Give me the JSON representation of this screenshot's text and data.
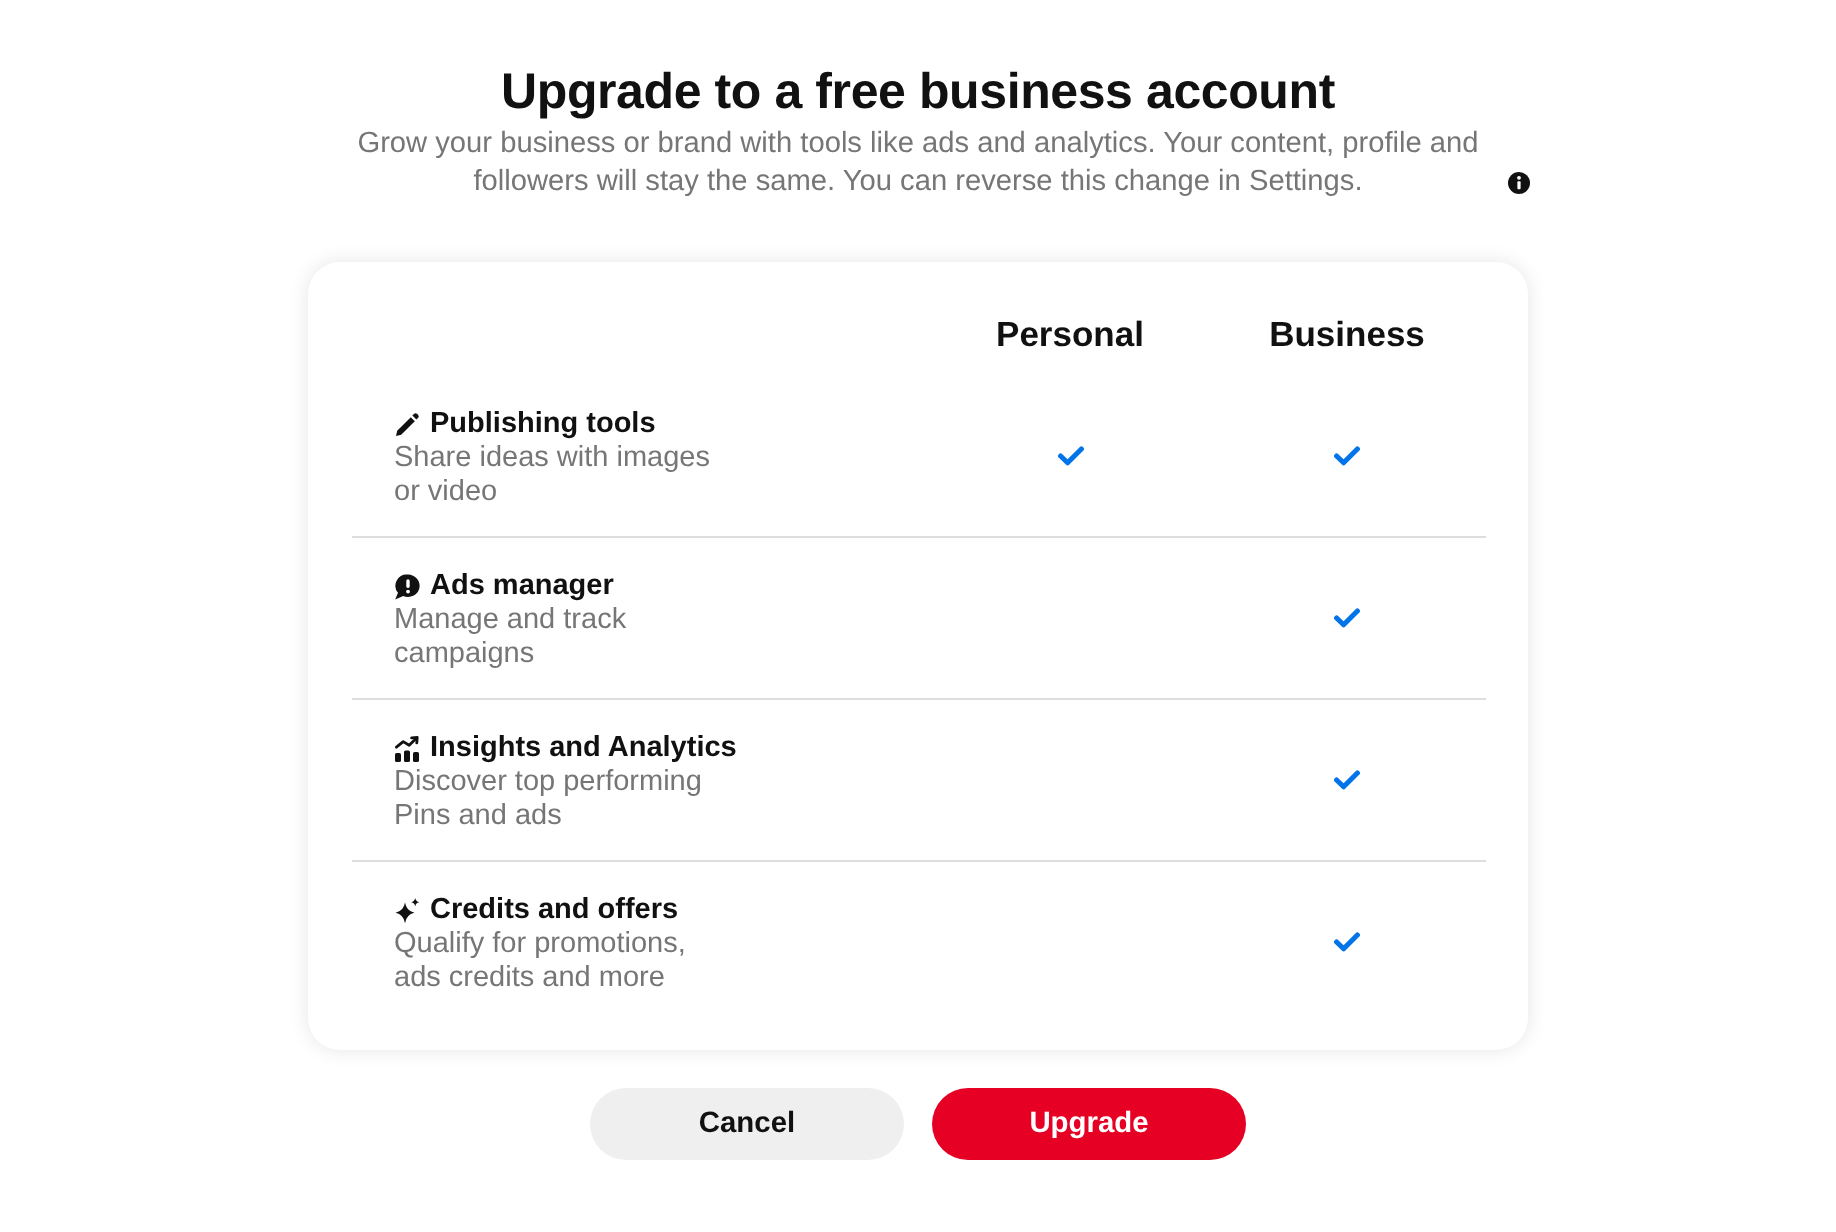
{
  "dialog": {
    "title": "Upgrade to a free business account",
    "subtitle": "Grow your business or brand with tools like ads and analytics. Your content, profile and followers will stay the same. You can reverse this change in Settings."
  },
  "comparison": {
    "columns": [
      "Personal",
      "Business"
    ],
    "features": [
      {
        "title": "Publishing tools",
        "description": "Share ideas with images or video",
        "personal": true,
        "business": true
      },
      {
        "title": "Ads manager",
        "description": "Manage and track campaigns",
        "personal": false,
        "business": true
      },
      {
        "title": "Insights and Analytics",
        "description": "Discover top performing Pins and ads",
        "personal": false,
        "business": true
      },
      {
        "title": "Credits and offers",
        "description": "Qualify for promotions, ads credits and more",
        "personal": false,
        "business": true
      }
    ]
  },
  "buttons": [
    {
      "label": "Cancel",
      "kind": "secondary"
    },
    {
      "label": "Upgrade",
      "kind": "primary"
    }
  ]
}
